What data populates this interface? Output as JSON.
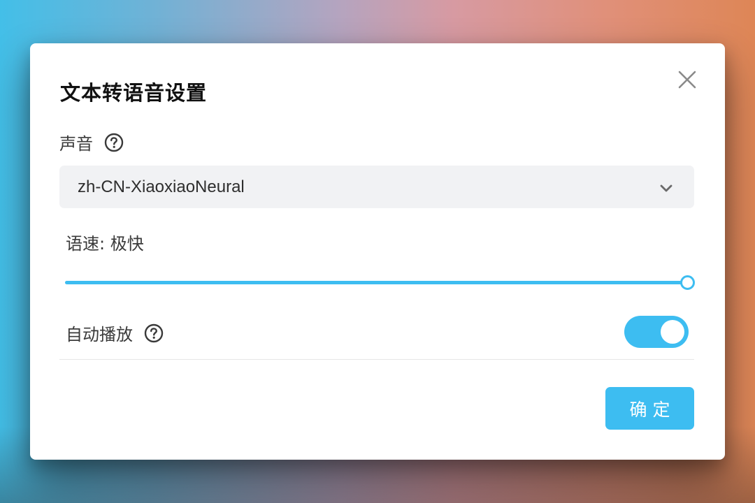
{
  "dialog": {
    "title": "文本转语音设置",
    "close_icon": "close-icon"
  },
  "voice": {
    "label": "声音",
    "help_icon": "question-circle-icon",
    "selected": "zh-CN-XiaoxiaoNeural"
  },
  "speed": {
    "label": "语速: 极快",
    "value_fraction": 1.0
  },
  "autoplay": {
    "label": "自动播放",
    "help_icon": "question-circle-icon",
    "enabled": true
  },
  "actions": {
    "confirm_label": "确定"
  },
  "colors": {
    "accent": "#3dbdf1",
    "select_bg": "#f1f2f4",
    "title": "#111111"
  }
}
